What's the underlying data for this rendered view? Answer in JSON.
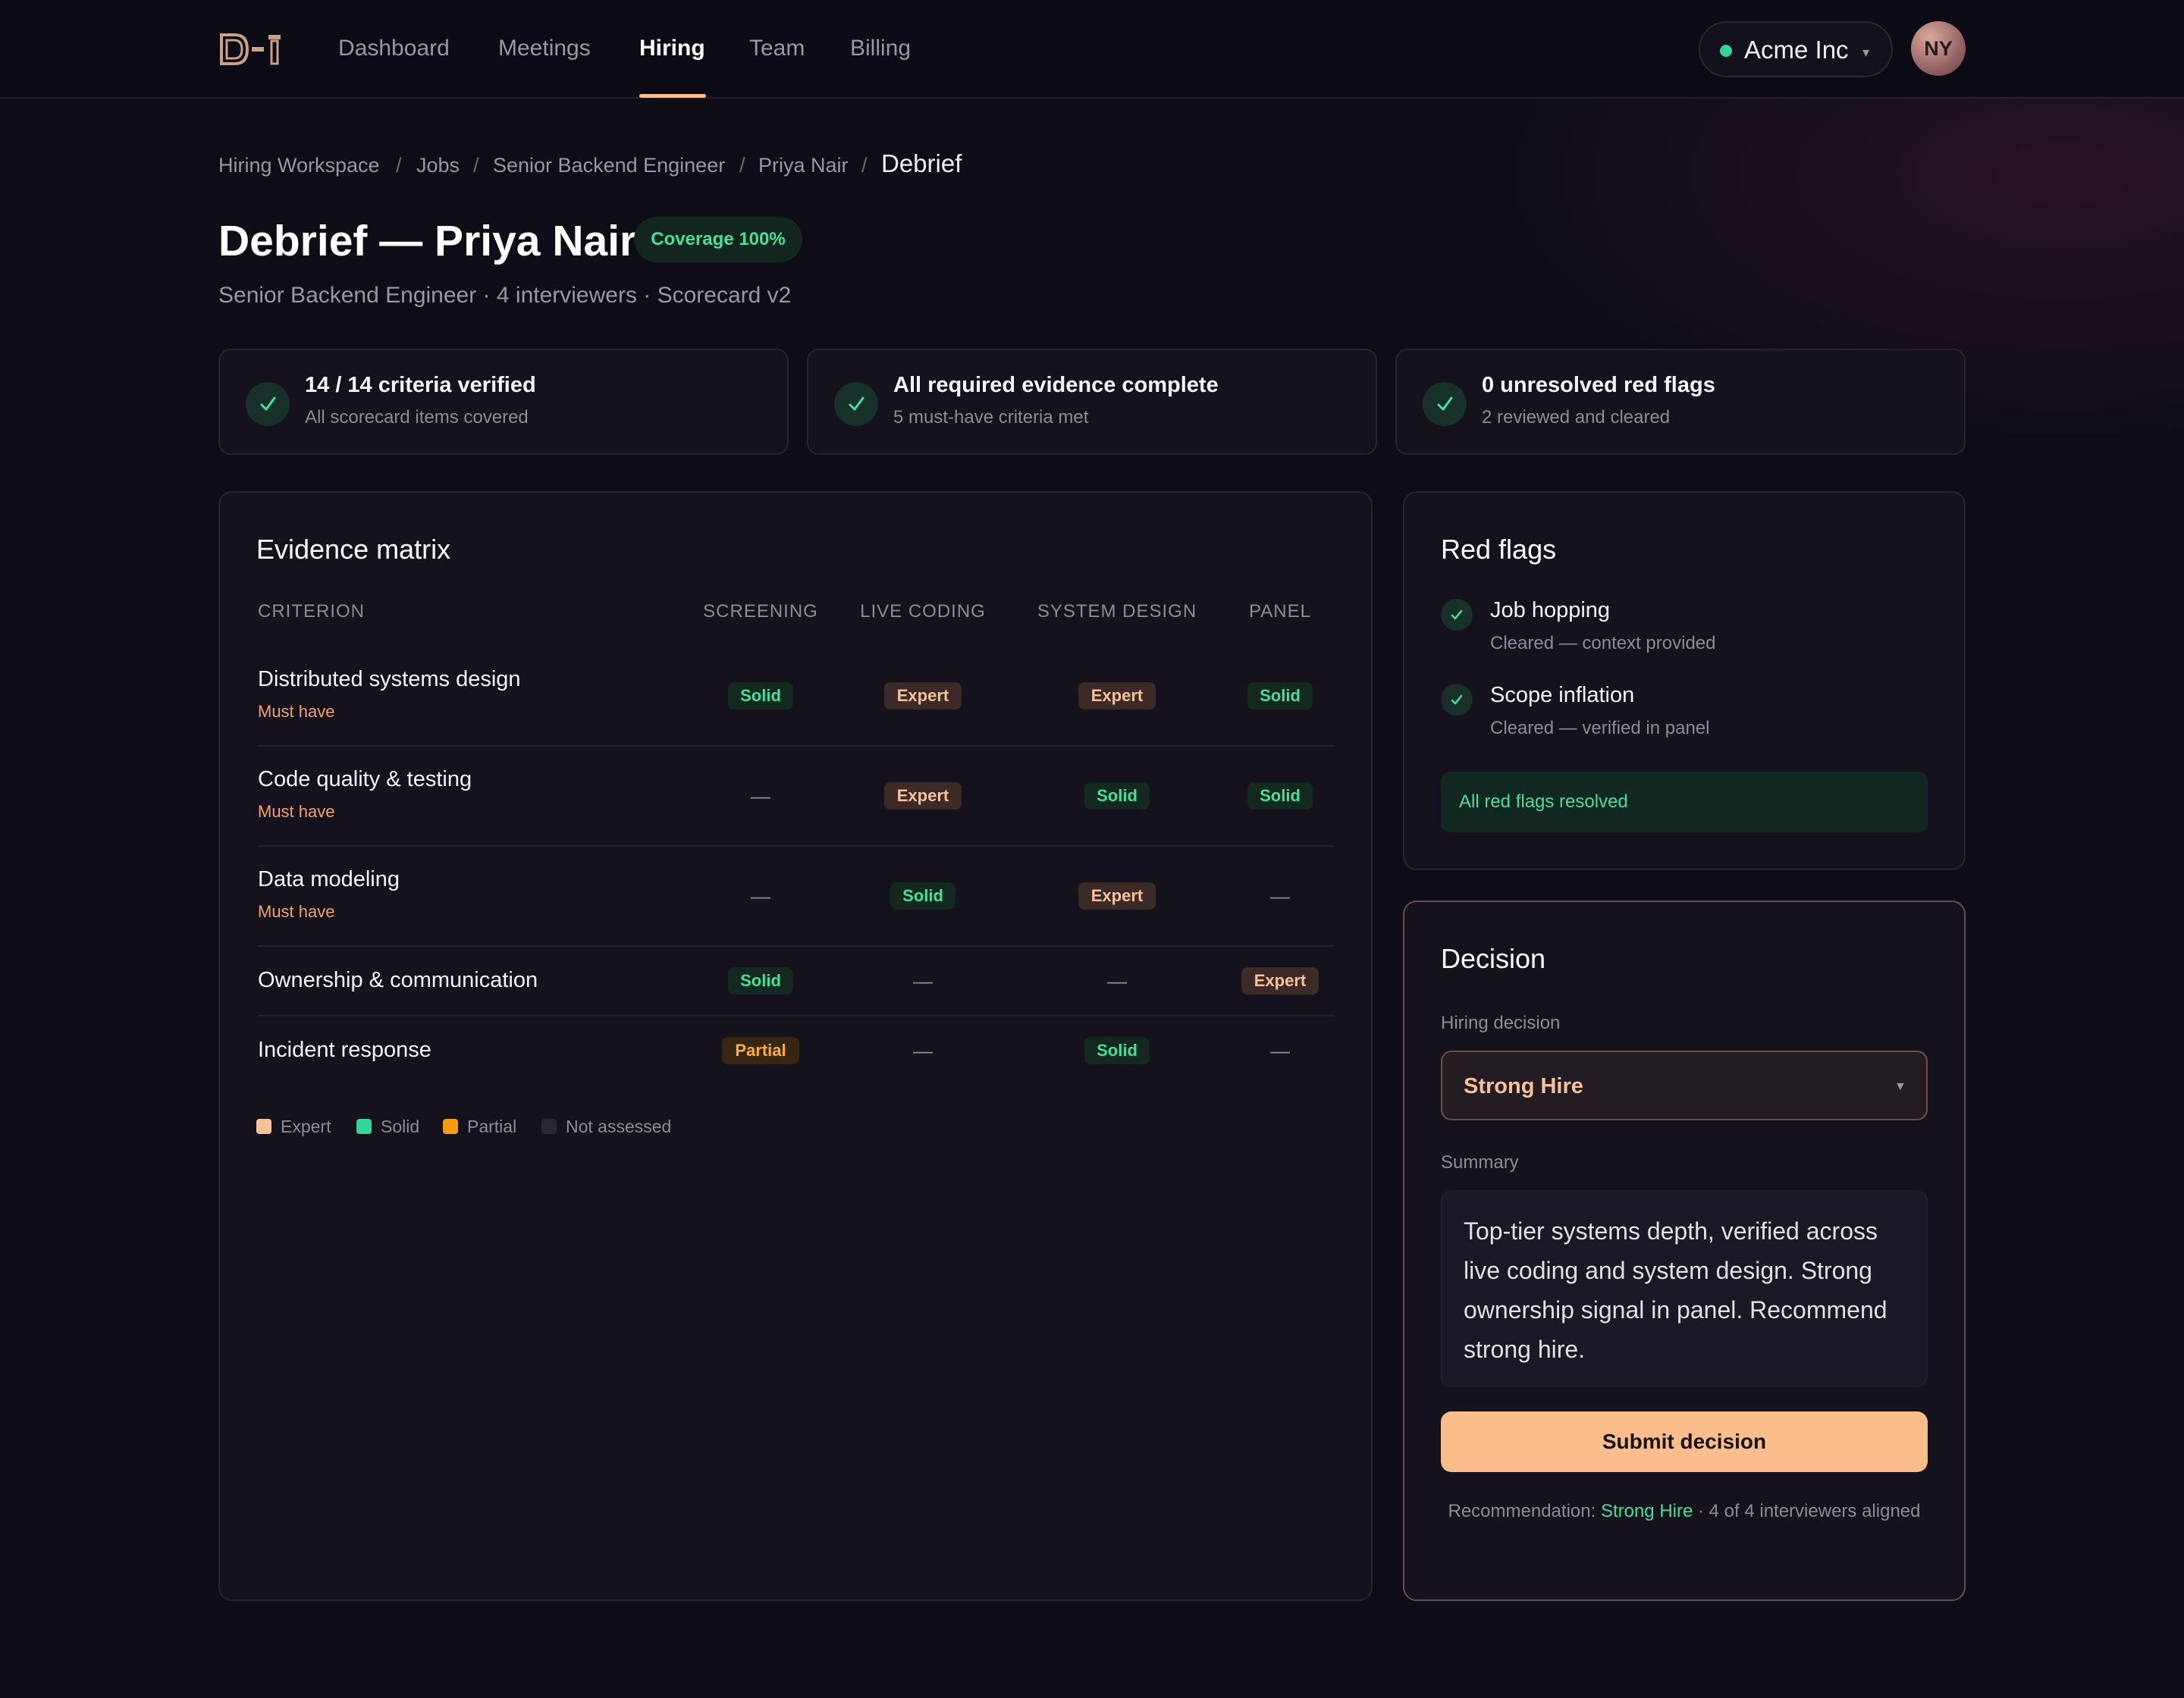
{
  "nav": {
    "logo_text": "D-1",
    "links": [
      "Dashboard",
      "Meetings",
      "Hiring",
      "Team",
      "Billing"
    ],
    "active": "Hiring",
    "org_name": "Acme Inc",
    "avatar_initials": "NY"
  },
  "breadcrumb": [
    "Hiring Workspace",
    "Jobs",
    "Senior Backend Engineer",
    "Priya Nair",
    "Debrief"
  ],
  "header": {
    "title": "Debrief — Priya Nair",
    "coverage_badge": "Coverage 100%",
    "subtitle": "Senior Backend Engineer · 4 interviewers · Scorecard v2"
  },
  "stats": [
    {
      "title": "14 / 14 criteria verified",
      "sub": "All scorecard items covered"
    },
    {
      "title": "All required evidence complete",
      "sub": "5 must-have criteria met"
    },
    {
      "title": "0 unresolved red flags",
      "sub": "2 reviewed and cleared"
    }
  ],
  "matrix": {
    "title": "Evidence matrix",
    "columns": [
      "CRITERION",
      "SCREENING",
      "LIVE CODING",
      "SYSTEM DESIGN",
      "PANEL"
    ],
    "rows": [
      {
        "label": "Distributed systems design",
        "tag": "Must have",
        "cells": [
          "Solid",
          "Expert",
          "Expert",
          "Solid"
        ]
      },
      {
        "label": "Code quality & testing",
        "tag": "Must have",
        "cells": [
          "—",
          "Expert",
          "Solid",
          "Solid"
        ]
      },
      {
        "label": "Data modeling",
        "tag": "Must have",
        "cells": [
          "—",
          "Solid",
          "Expert",
          "—"
        ]
      },
      {
        "label": "Ownership & communication",
        "tag": "",
        "cells": [
          "Solid",
          "—",
          "—",
          "Expert"
        ]
      },
      {
        "label": "Incident response",
        "tag": "",
        "cells": [
          "Partial",
          "—",
          "Solid",
          "—"
        ]
      }
    ],
    "legend": [
      {
        "label": "Expert",
        "color": "#f7c29a"
      },
      {
        "label": "Solid",
        "color": "#34d399"
      },
      {
        "label": "Partial",
        "color": "#f59e0b"
      },
      {
        "label": "Not assessed",
        "color": "#2a2733"
      }
    ]
  },
  "red_flags": {
    "title": "Red flags",
    "items": [
      {
        "title": "Job hopping",
        "sub": "Cleared — context provided"
      },
      {
        "title": "Scope inflation",
        "sub": "Cleared — verified in panel"
      }
    ],
    "resolved_text": "All red flags resolved"
  },
  "decision": {
    "title": "Decision",
    "hiring_label": "Hiring decision",
    "selected": "Strong Hire",
    "summary_label": "Summary",
    "summary": "Top-tier systems depth, verified across live coding and system design. Strong ownership signal in panel. Recommend strong hire.",
    "submit_label": "Submit decision",
    "rec_prefix": "Recommendation: ",
    "rec_value": "Strong Hire",
    "rec_suffix": " · 4 of 4 interviewers aligned"
  },
  "colors": {
    "accent": "#fbbd8c",
    "success": "#4ade9a",
    "background": "#0e0c17"
  }
}
